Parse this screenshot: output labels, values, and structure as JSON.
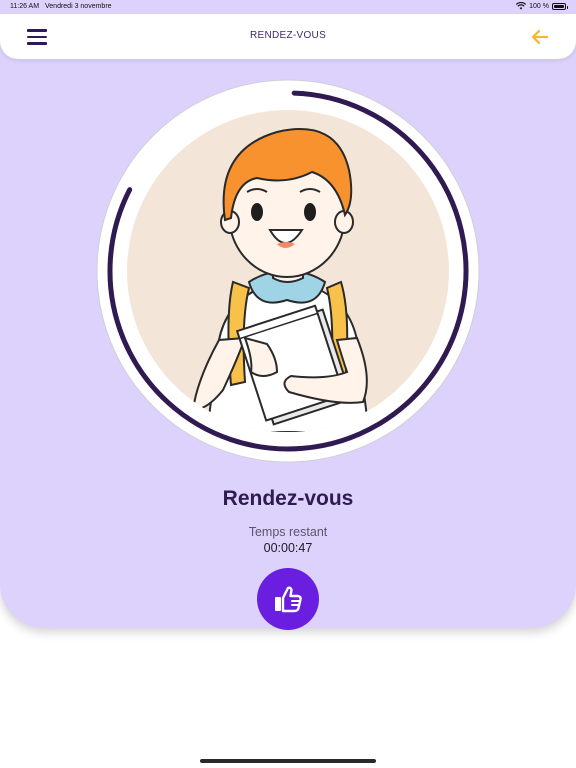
{
  "statusbar": {
    "time": "11:26 AM",
    "date": "Vendredi 3 novembre",
    "battery": "100 %",
    "wifi_icon": "wifi-icon",
    "battery_icon": "battery-full-icon"
  },
  "navbar": {
    "title": "RENDEZ-VOUS",
    "menu_icon": "hamburger-menu-icon",
    "back_icon": "arrow-left-icon"
  },
  "main": {
    "image": "child-with-books-illustration",
    "title": "Rendez-vous",
    "remaining_label": "Temps restant",
    "remaining_time": "00:00:47",
    "progress_ring_fraction": 0.82,
    "action_icon": "thumbs-up-icon"
  },
  "colors": {
    "background": "#dcd2fb",
    "accent": "#6a1fe0",
    "back_arrow": "#f5b82e",
    "ring": "#2f1b52"
  }
}
